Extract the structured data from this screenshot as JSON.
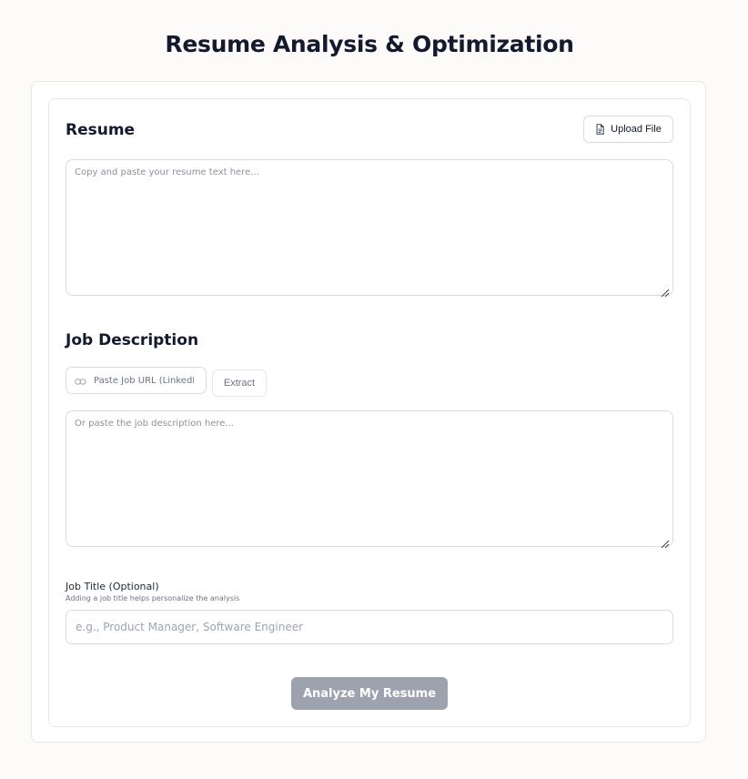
{
  "header": {
    "title": "Resume Analysis & Optimization"
  },
  "resume": {
    "heading": "Resume",
    "upload_label": "Upload File",
    "placeholder": "Copy and paste your resume text here..."
  },
  "job": {
    "heading": "Job Description",
    "url_placeholder": "Paste Job URL (LinkedIn",
    "extract_label": "Extract",
    "placeholder": "Or paste the job description here..."
  },
  "job_title": {
    "label": "Job Title (Optional)",
    "help": "Adding a job title helps personalize the analysis",
    "placeholder": "e.g., Product Manager, Software Engineer"
  },
  "actions": {
    "analyze_label": "Analyze My Resume",
    "analyze_color": "#9ca3af"
  },
  "icons": {
    "upload": "file-text-icon",
    "url": "link-icon",
    "resize": "resize-grip-icon"
  }
}
